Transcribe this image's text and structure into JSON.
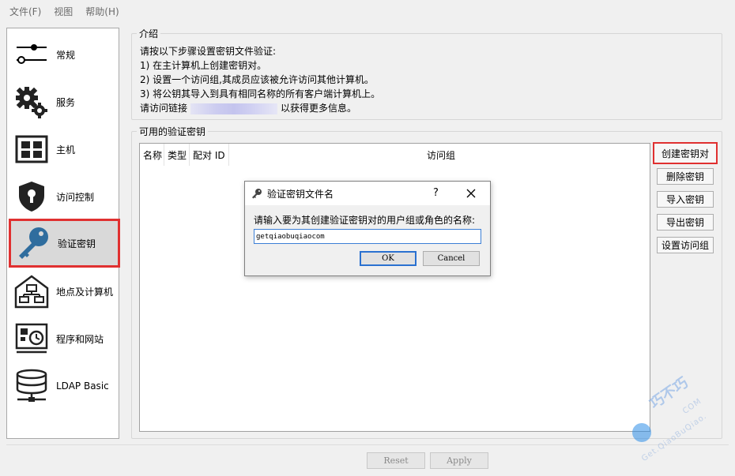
{
  "menubar": {
    "file": "文件(F)",
    "view": "视图",
    "help": "帮助(H)"
  },
  "sidebar": {
    "items": [
      {
        "label": "常规",
        "icon": "sliders-icon"
      },
      {
        "label": "服务",
        "icon": "gears-icon"
      },
      {
        "label": "主机",
        "icon": "grid-icon"
      },
      {
        "label": "访问控制",
        "icon": "shield-lock-icon"
      },
      {
        "label": "验证密钥",
        "icon": "key-icon"
      },
      {
        "label": "地点及计算机",
        "icon": "house-network-icon"
      },
      {
        "label": "程序和网站",
        "icon": "program-clock-icon"
      },
      {
        "label": "LDAP Basic",
        "icon": "database-icon"
      }
    ]
  },
  "intro": {
    "title": "介绍",
    "line1": "请按以下步骤设置密钥文件验证:",
    "line2": "1) 在主计算机上创建密钥对。",
    "line3": "2) 设置一个访问组,其成员应该被允许访问其他计算机。",
    "line4": "3) 将公钥其导入到具有相同名称的所有客户端计算机上。",
    "line5_pre": "请访问链接",
    "line5_post": "以获得更多信息。"
  },
  "keys": {
    "title": "可用的验证密钥",
    "columns": [
      "名称",
      "类型",
      "配对 ID",
      "访问组"
    ],
    "buttons": {
      "create": "创建密钥对",
      "delete": "删除密钥",
      "import": "导入密钥",
      "export": "导出密钥",
      "set_group": "设置访问组"
    }
  },
  "bottom": {
    "reset": "Reset",
    "apply": "Apply"
  },
  "dialog": {
    "title": "验证密钥文件名",
    "help": "?",
    "prompt": "请输入要为其创建验证密钥对的用户组或角色的名称:",
    "input_value": "getqiaobuqiaocom",
    "ok": "OK",
    "cancel": "Cancel"
  },
  "watermark": {
    "main": "巧不巧",
    "sub1": "Get.QiaoBuQiao.",
    "sub2": "COM"
  },
  "colors": {
    "highlight": "#e03030",
    "accent": "#3c7fd6",
    "key_blue": "#2f6d9e"
  }
}
